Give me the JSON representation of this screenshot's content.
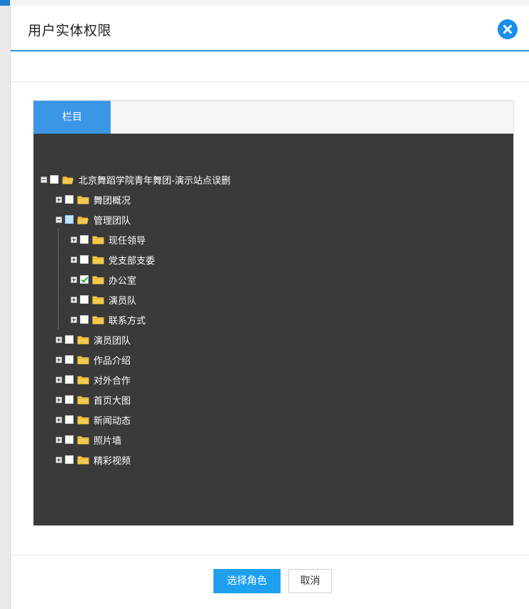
{
  "dialog": {
    "title": "用户实体权限"
  },
  "tabs": [
    {
      "label": "栏目",
      "active": true
    }
  ],
  "tree": {
    "root": {
      "label": "北京舞蹈学院青年舞团-演示站点误删",
      "expanded": true,
      "check": "none"
    },
    "nodes": [
      {
        "label": "舞团概况",
        "expanded": false,
        "check": "none"
      },
      {
        "label": "管理团队",
        "expanded": true,
        "check": "partial",
        "children": [
          {
            "label": "现任领导",
            "check": "none"
          },
          {
            "label": "党支部支委",
            "check": "none"
          },
          {
            "label": "办公室",
            "check": "checked"
          },
          {
            "label": "演员队",
            "check": "none"
          },
          {
            "label": "联系方式",
            "check": "none"
          }
        ]
      },
      {
        "label": "演员团队",
        "expanded": false,
        "check": "none"
      },
      {
        "label": "作品介绍",
        "expanded": false,
        "check": "none"
      },
      {
        "label": "对外合作",
        "expanded": false,
        "check": "none"
      },
      {
        "label": "首页大图",
        "expanded": false,
        "check": "none"
      },
      {
        "label": "新闻动态",
        "expanded": false,
        "check": "none"
      },
      {
        "label": "照片墙",
        "expanded": false,
        "check": "none"
      },
      {
        "label": "精彩视频",
        "expanded": false,
        "check": "none"
      }
    ]
  },
  "footer": {
    "confirm_label": "选择角色",
    "cancel_label": "取消"
  },
  "colors": {
    "accent": "#1ea0ef",
    "tab_active": "#3c96e6",
    "tree_bg": "#3a3a3a",
    "folder": "#f2c94c",
    "close_button": "#1a8fe8"
  },
  "icons": [
    "close-icon",
    "folder-open-icon",
    "folder-icon",
    "expand-plus-icon",
    "collapse-minus-icon",
    "checkbox-icon"
  ]
}
